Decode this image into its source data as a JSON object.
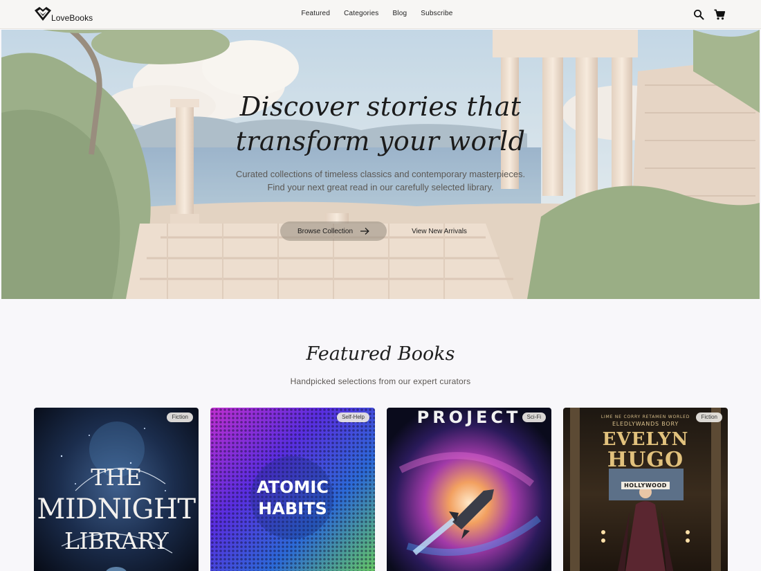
{
  "header": {
    "brand": "LoveBooks",
    "nav": [
      "Featured",
      "Categories",
      "Blog",
      "Subscribe"
    ],
    "icons": [
      "search-icon",
      "cart-icon",
      "logo-heart-icon"
    ]
  },
  "hero": {
    "title_line1": "Discover stories that",
    "title_line2": "transform your world",
    "subtitle": "Curated collections of timeless classics and contemporary masterpieces. Find your next great read in our carefully selected library.",
    "primary_button": "Browse Collection",
    "secondary_button": "View New Arrivals"
  },
  "featured": {
    "title": "Featured Books",
    "subtitle": "Handpicked selections from our expert curators",
    "books": [
      {
        "genre": "Fiction",
        "cover_lines": [
          "THE",
          "MIDNIGHT",
          "LIBRARY"
        ]
      },
      {
        "genre": "Self-Help",
        "cover_lines": [
          "ATOMIC",
          "HABITS"
        ]
      },
      {
        "genre": "Sci-Fi",
        "cover_lines": [
          "PROJECT"
        ]
      },
      {
        "genre": "Fiction",
        "cover_lines": [
          "LIME NE CORRY RETAMEN WORLED",
          "ELEDLYWANDS BORY",
          "EVELYN",
          "HUGO",
          "HOLLYWOOD"
        ]
      }
    ]
  },
  "colors": {
    "page_bg": "#f8f7fa",
    "header_bg": "#f7f6f4",
    "text": "#1b1b1b",
    "muted": "#5a5652",
    "badge_bg": "#ebe8e4"
  }
}
